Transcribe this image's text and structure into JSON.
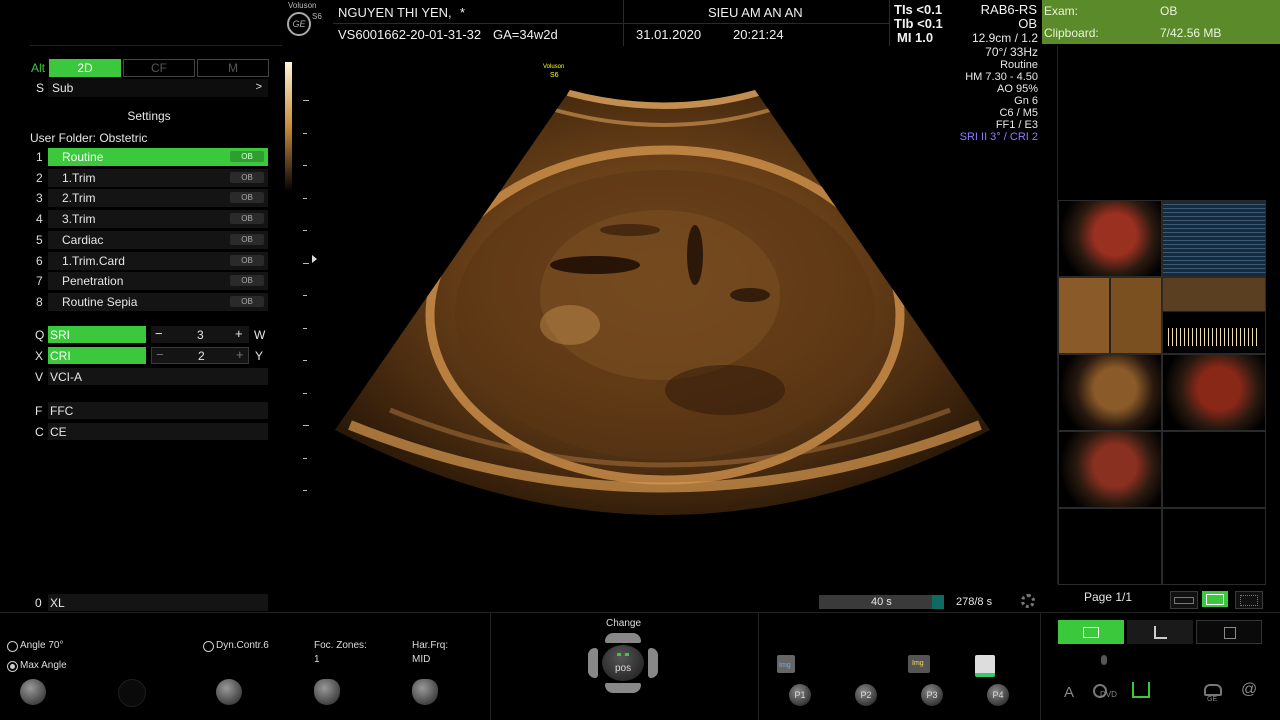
{
  "header": {
    "logo_brand": "Voluson",
    "logo_model": "S6",
    "patient_name": "NGUYEN THI YEN,",
    "patient_flag": "*",
    "patient_id": "VS6001662-20-01-31-32",
    "ga": "GA=34w2d",
    "clinic": "SIEU AM AN AN",
    "date": "31.01.2020",
    "time": "20:21:24",
    "tis": "TIs <0.1",
    "tib": "TIb <0.1",
    "mi": "MI  1.0",
    "probe": "RAB6-RS",
    "app": "OB"
  },
  "exam_panel": {
    "exam_label": "Exam:",
    "exam_value": "OB",
    "clipboard_label": "Clipboard:",
    "clipboard_value": "7/42.56 MB"
  },
  "modes": {
    "alt_label": "Alt",
    "mode_2d": "2D",
    "mode_cf": "CF",
    "mode_m": "M",
    "sub_key": "S",
    "sub_label": "Sub",
    "sub_arrow": ">"
  },
  "settings": {
    "title": "Settings",
    "folder": "User Folder: Obstetric",
    "presets": [
      {
        "num": "1",
        "label": "Routine",
        "tag": "OB"
      },
      {
        "num": "2",
        "label": "1.Trim",
        "tag": "OB"
      },
      {
        "num": "3",
        "label": "2.Trim",
        "tag": "OB"
      },
      {
        "num": "4",
        "label": "3.Trim",
        "tag": "OB"
      },
      {
        "num": "5",
        "label": "Cardiac",
        "tag": "OB"
      },
      {
        "num": "6",
        "label": "1.Trim.Card",
        "tag": "OB"
      },
      {
        "num": "7",
        "label": "Penetration",
        "tag": "OB"
      },
      {
        "num": "8",
        "label": "Routine Sepia",
        "tag": "OB"
      }
    ]
  },
  "controls": {
    "sri_key": "Q",
    "sri_label": "SRI",
    "sri_minus": "−",
    "sri_value": "3",
    "sri_plus": "+",
    "sri_right": "W",
    "cri_key": "X",
    "cri_label": "CRI",
    "cri_minus": "−",
    "cri_value": "2",
    "cri_plus": "+",
    "cri_right": "Y",
    "vci_key": "V",
    "vci_label": "VCI-A",
    "ffc_key": "F",
    "ffc_label": "FFC",
    "ce_key": "C",
    "ce_label": "CE",
    "xl_key": "0",
    "xl_label": "XL"
  },
  "image_params": {
    "depth": "12.9cm / 1.2",
    "angle_fps": "70°/ 33Hz",
    "preset": "Routine",
    "hm": "HM  7.30 - 4.50",
    "ao": "AO 95%",
    "gn": "Gn  6",
    "c_m": "C6 / M5",
    "ff_e": "FF1 / E3",
    "sri_cri": "SRI II 3° / CRI 2",
    "sri_color": "#8c7cff",
    "probe_mark_brand": "Voluson",
    "probe_mark_model": "S6"
  },
  "cine": {
    "duration": "40 s",
    "frames": "278/8 s",
    "progress_fraction": 0.1
  },
  "gallery": {
    "page": "Page 1/1"
  },
  "bottom": {
    "angle": "Angle 70°",
    "max_angle": "Max Angle",
    "dyn_contr": "Dyn.Contr.6",
    "foc_label": "Foc. Zones:",
    "foc_value": "1",
    "harfrq_label": "Har.Frq:",
    "harfrq_value": "MID",
    "change_label": "Change",
    "pos_label": "pos",
    "p1": "P1",
    "p2": "P2",
    "p3": "P3",
    "p4": "P4",
    "img_label": "Img",
    "dvd_label": "DVD",
    "ge_label": "GE"
  },
  "colors": {
    "accent_green": "#3cc83c",
    "exam_panel": "#5a8a2a",
    "sepia": "#c88a3c"
  }
}
